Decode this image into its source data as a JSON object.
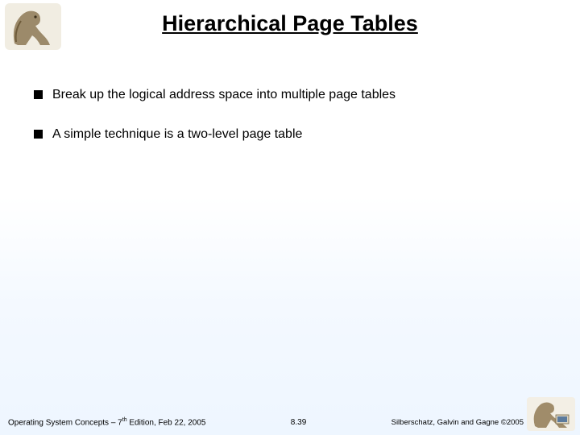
{
  "title": "Hierarchical Page Tables",
  "bullets": [
    "Break up the logical address space into multiple page tables",
    "A simple technique is a two-level page table"
  ],
  "footer": {
    "left_pre": "Operating System Concepts – 7",
    "left_sup": "th",
    "left_post": " Edition, Feb 22, 2005",
    "center": "8.39",
    "right": "Silberschatz, Galvin and Gagne ©2005"
  }
}
